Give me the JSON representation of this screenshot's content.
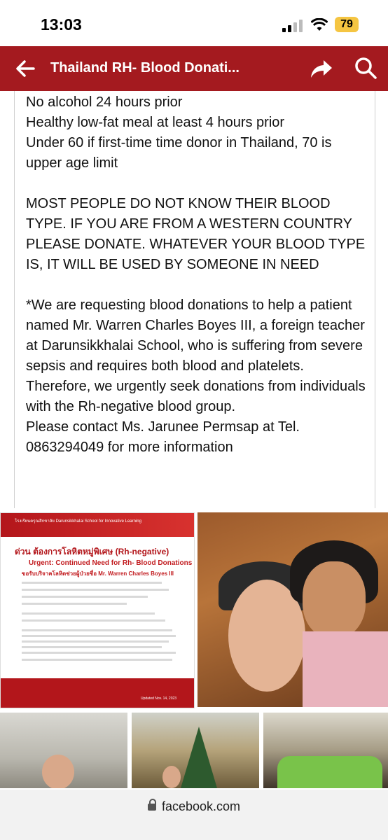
{
  "status_bar": {
    "time": "13:03",
    "battery": "79",
    "signal_icon": "cellular-signal-icon",
    "wifi_icon": "wifi-icon"
  },
  "app_bar": {
    "title": "Thailand RH- Blood Donati...",
    "back_icon": "arrow-left-icon",
    "share_icon": "share-arrow-icon",
    "search_icon": "search-icon",
    "color": "#a41a1f"
  },
  "post": {
    "paragraphs": [
      "No alcohol 24 hours prior\nHealthy low-fat meal at least 4 hours prior\nUnder 60 if first-time time donor in Thailand, 70 is upper age limit",
      "MOST PEOPLE DO NOT KNOW THEIR BLOOD TYPE.  IF YOU ARE FROM A WESTERN COUNTRY PLEASE DONATE.   WHATEVER YOUR BLOOD TYPE IS, IT WILL BE USED BY SOMEONE IN NEED",
      "*We are requesting blood donations to help a patient named Mr. Warren Charles Boyes III, a foreign teacher at Darunsikkhalai School, who is suffering from severe sepsis and requires both blood and platelets.\nTherefore, we urgently seek donations from individuals with the Rh-negative blood group.\nPlease contact Ms. Jarunee Permsap at Tel. 0863294049 for more information"
    ]
  },
  "poster": {
    "school": "โรงเรียนดรุณสิกขาลัย DarunsikkhaIai School for Innovative Learning",
    "thai_headline": "ด่วน ต้องการโลหิตหมู่พิเศษ (Rh-negative)",
    "english_headline": "Urgent: Continued Need for Rh- Blood Donations",
    "subtitle": "ขอรับบริจาคโลหิตช่วยผู้ป่วยชื่อ Mr. Warren Charles Boyes III",
    "updated": "Updated Nov. 14, 2023"
  },
  "url_bar": {
    "url": "facebook.com",
    "lock_icon": "lock-icon"
  }
}
